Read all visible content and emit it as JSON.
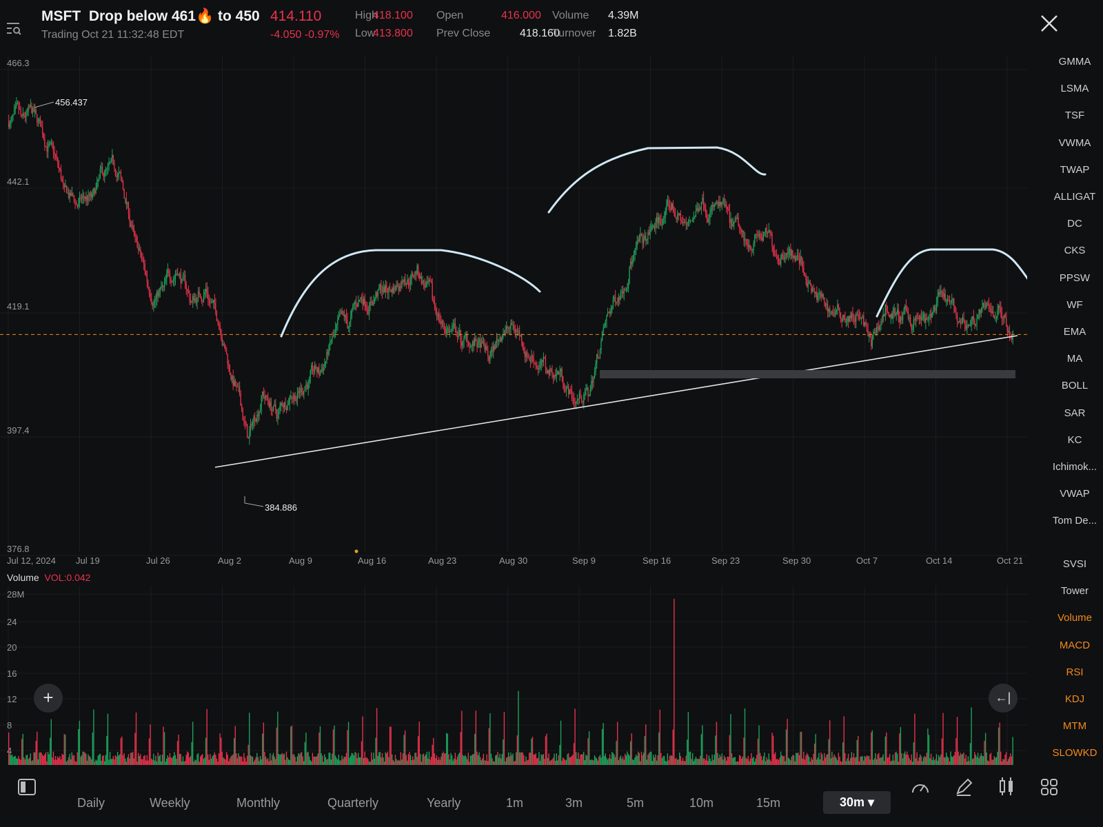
{
  "header": {
    "symbol": "MSFT",
    "alert_note_before": "Drop below 461",
    "alert_note_after": "to 450",
    "fire_emoji": "🔥",
    "last_price": "414.110",
    "status": "Trading Oct 21 11:32:48 EDT",
    "change": "-4.050 -0.97%",
    "stats": [
      {
        "label": "High",
        "value": "418.100",
        "color": "red"
      },
      {
        "label": "Open",
        "value": "416.000",
        "color": "red"
      },
      {
        "label": "Volume",
        "value": "4.39M",
        "color": "white"
      },
      {
        "label": "Low",
        "value": "413.800",
        "color": "red"
      },
      {
        "label": "Prev Close",
        "value": "418.160",
        "color": "white"
      },
      {
        "label": "Turnover",
        "value": "1.82B",
        "color": "white"
      }
    ]
  },
  "indicators_main": [
    "GMMA",
    "LSMA",
    "TSF",
    "VWMA",
    "TWAP",
    "ALLIGAT",
    "DC",
    "CKS",
    "PPSW",
    "WF",
    "EMA",
    "MA",
    "BOLL",
    "SAR",
    "KC",
    "Ichimok...",
    "VWAP",
    "Tom De..."
  ],
  "indicators_sub": [
    {
      "label": "SVSI",
      "active": false
    },
    {
      "label": "Tower",
      "active": false
    },
    {
      "label": "Volume",
      "active": true
    },
    {
      "label": "MACD",
      "active": true
    },
    {
      "label": "RSI",
      "active": true
    },
    {
      "label": "KDJ",
      "active": true
    },
    {
      "label": "MTM",
      "active": true
    },
    {
      "label": "SLOWKD",
      "active": true
    }
  ],
  "volume_panel": {
    "title": "Volume",
    "vol_label": "VOL:0.042"
  },
  "timeframes": [
    "Daily",
    "Weekly",
    "Monthly",
    "Quarterly",
    "Yearly",
    "1m",
    "3m",
    "5m",
    "10m",
    "15m"
  ],
  "selected_timeframe": "30m",
  "colors": {
    "up": "#1fa35c",
    "down": "#e8334c",
    "accent": "#f28a1c",
    "background": "#0f1012"
  },
  "chart_data": {
    "type": "candlestick",
    "interval": "30m",
    "price_axis_ticks": [
      "466.3",
      "442.1",
      "419.1",
      "397.4",
      "376.8"
    ],
    "price_range": [
      376.8,
      466.3
    ],
    "x_tick_labels": [
      "Jul 12, 2024",
      "Jul 19",
      "Jul 26",
      "Aug 2",
      "Aug 9",
      "Aug 16",
      "Aug 23",
      "Aug 30",
      "Sep 9",
      "Sep 16",
      "Sep 23",
      "Sep 30",
      "Oct 7",
      "Oct 14",
      "Oct 21"
    ],
    "high_marker": "456.437",
    "low_marker": "384.886",
    "current_price_line": 414.11,
    "daily_close_approx": {
      "dates": [
        "Jul 12",
        "Jul 15",
        "Jul 16",
        "Jul 17",
        "Jul 18",
        "Jul 19",
        "Jul 22",
        "Jul 23",
        "Jul 24",
        "Jul 25",
        "Jul 26",
        "Jul 29",
        "Jul 30",
        "Jul 31",
        "Aug 1",
        "Aug 2",
        "Aug 5",
        "Aug 6",
        "Aug 7",
        "Aug 8",
        "Aug 9",
        "Aug 12",
        "Aug 13",
        "Aug 14",
        "Aug 15",
        "Aug 16",
        "Aug 19",
        "Aug 20",
        "Aug 21",
        "Aug 22",
        "Aug 23",
        "Aug 26",
        "Aug 27",
        "Aug 28",
        "Aug 29",
        "Aug 30",
        "Sep 3",
        "Sep 4",
        "Sep 5",
        "Sep 6",
        "Sep 9",
        "Sep 10",
        "Sep 11",
        "Sep 12",
        "Sep 13",
        "Sep 16",
        "Sep 17",
        "Sep 18",
        "Sep 19",
        "Sep 20",
        "Sep 23",
        "Sep 24",
        "Sep 25",
        "Sep 26",
        "Sep 27",
        "Sep 30",
        "Oct 1",
        "Oct 2",
        "Oct 3",
        "Oct 4",
        "Oct 7",
        "Oct 8",
        "Oct 9",
        "Oct 10",
        "Oct 11",
        "Oct 14",
        "Oct 15",
        "Oct 16",
        "Oct 17",
        "Oct 18",
        "Oct 21"
      ],
      "close": [
        451.5,
        452.1,
        446.7,
        438.9,
        436.5,
        437.7,
        442.5,
        441.3,
        430.4,
        422.0,
        422.0,
        425.6,
        419.6,
        422.0,
        416.0,
        405.1,
        395.5,
        403.9,
        400.3,
        403.9,
        405.1,
        407.5,
        413.6,
        416.0,
        420.8,
        420.8,
        422.0,
        424.4,
        425.6,
        420.8,
        414.8,
        413.6,
        412.3,
        409.9,
        414.8,
        414.8,
        409.9,
        408.7,
        407.5,
        402.7,
        403.9,
        413.6,
        420.8,
        426.8,
        430.4,
        434.0,
        436.5,
        432.8,
        437.7,
        436.5,
        434.0,
        430.4,
        431.6,
        430.4,
        429.2,
        426.8,
        420.8,
        418.4,
        417.2,
        417.2,
        412.3,
        418.4,
        417.2,
        416.0,
        416.0,
        420.8,
        417.2,
        416.0,
        418.4,
        418.4,
        414.1
      ]
    },
    "volume_axis_ticks": [
      "28M",
      "24",
      "20",
      "16",
      "12",
      "8",
      "4"
    ],
    "volume_range": [
      0,
      28
    ]
  }
}
